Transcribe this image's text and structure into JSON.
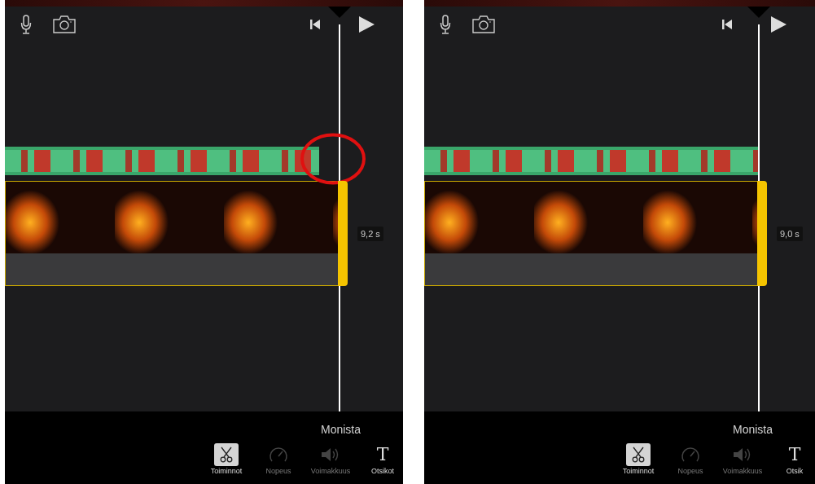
{
  "panels": [
    {
      "overlay_aligned": false,
      "highlight_circle": true,
      "duration": "9,2 s",
      "action": "Monista",
      "tools": [
        {
          "kind": "scissors",
          "label": "Toiminnot",
          "selected": true,
          "disabled": false
        },
        {
          "kind": "speed",
          "label": "Nopeus",
          "selected": false,
          "disabled": true
        },
        {
          "kind": "volume",
          "label": "Voimakkuus",
          "selected": false,
          "disabled": true
        },
        {
          "kind": "title",
          "glyph": "T",
          "label": "Otsikot",
          "selected": false,
          "disabled": false
        }
      ]
    },
    {
      "overlay_aligned": true,
      "highlight_circle": false,
      "duration": "9,0 s",
      "action": "Monista",
      "tools": [
        {
          "kind": "scissors",
          "label": "Toiminnot",
          "selected": true,
          "disabled": false
        },
        {
          "kind": "speed",
          "label": "Nopeus",
          "selected": false,
          "disabled": true
        },
        {
          "kind": "volume",
          "label": "Voimakkuus",
          "selected": false,
          "disabled": true
        },
        {
          "kind": "title",
          "glyph": "T",
          "label": "Otsik",
          "selected": false,
          "disabled": false
        }
      ]
    }
  ]
}
